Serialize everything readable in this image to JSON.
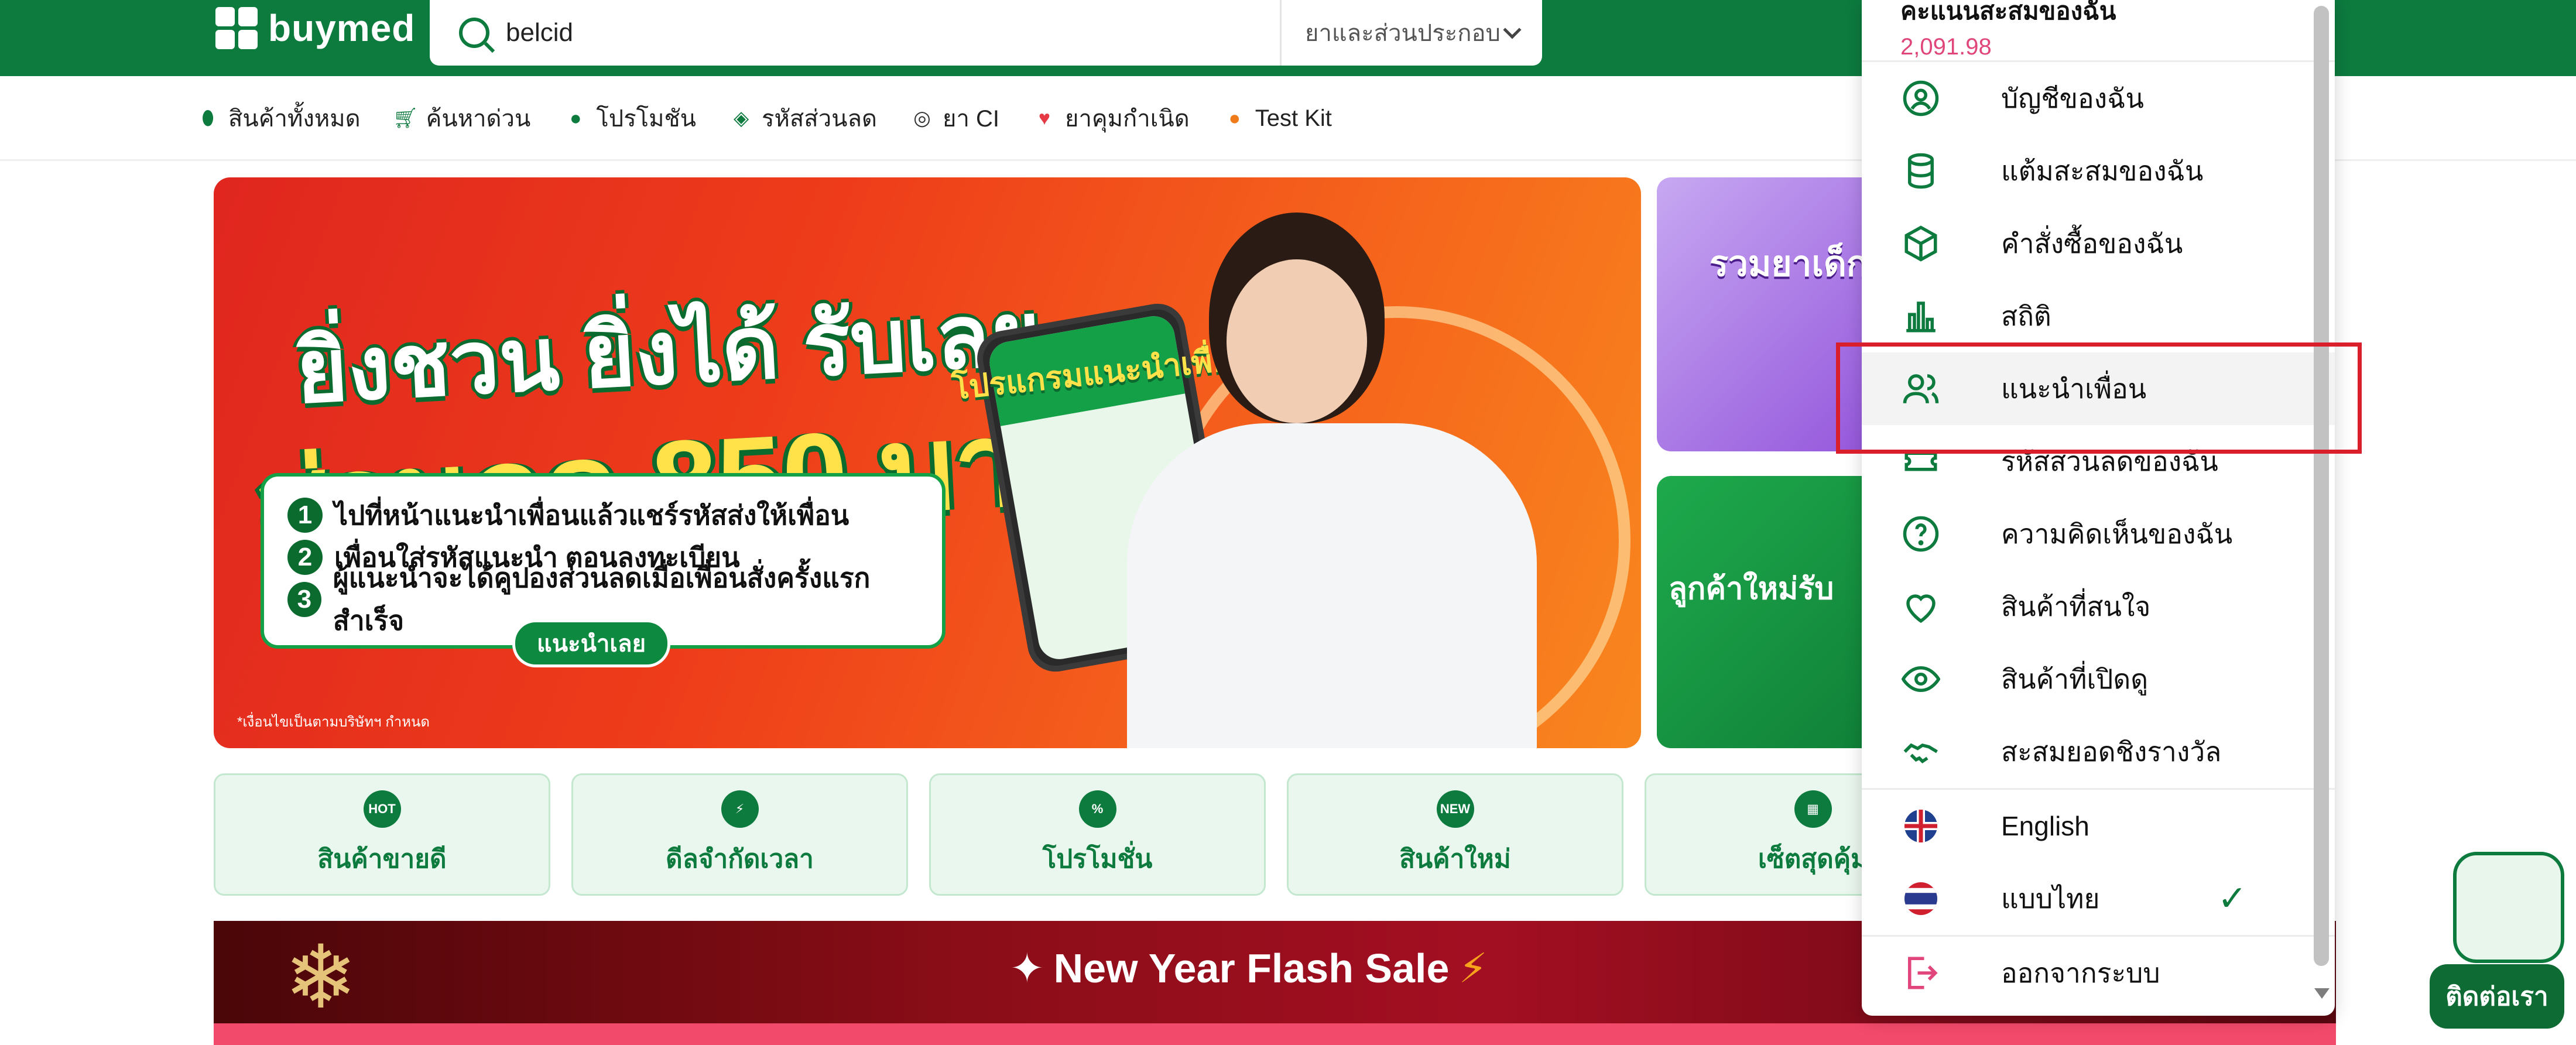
{
  "header": {
    "logo_text": "buymed",
    "search_value": "belcid",
    "search_category": "ยาและส่วนประกอบ"
  },
  "nav": {
    "items": [
      {
        "label": "สินค้าทั้งหมด",
        "icon": "pill-icon"
      },
      {
        "label": "ค้นหาด่วน",
        "icon": "cart-icon"
      },
      {
        "label": "โปรโมชัน",
        "icon": "flame-icon"
      },
      {
        "label": "รหัสส่วนลด",
        "icon": "coupon-icon"
      },
      {
        "label": "ยา CI",
        "icon": "medical-icon"
      },
      {
        "label": "ยาคุมกำเนิด",
        "icon": "heart-icon"
      },
      {
        "label": "Test Kit",
        "icon": "fire-icon"
      }
    ]
  },
  "banner": {
    "headline1": "ยิ่งชวน ยิ่งได้ รับเลย",
    "headline2": "ส่วนลด 850 บาท",
    "tag": "โปรแกรมแนะนำเพื่อน",
    "steps": [
      "ไปที่หน้าแนะนำเพื่อนแล้วแชร์รหัสส่งให้เพื่อน",
      "เพื่อนใส่รหัสแนะนำ ตอนลงทะเบียน",
      "ผู้แนะนำจะได้คูปองส่วนลดเมื่อเพื่อนสั่งครั้งแรกสำเร็จ"
    ],
    "cta": "แนะนำเลย",
    "note": "*เงื่อนไขเป็นตามบริษัทฯ กำหนด"
  },
  "side_banners": {
    "top_title": "รวมยาเด็ก",
    "bottom_title": "ลูกค้าใหม่รับ"
  },
  "categories": [
    {
      "label": "สินค้าขายดี",
      "icon_text": "HOT"
    },
    {
      "label": "ดีลจำกัดเวลา",
      "icon_text": "⚡"
    },
    {
      "label": "โปรโมชั่น",
      "icon_text": "%"
    },
    {
      "label": "สินค้าใหม่",
      "icon_text": "NEW"
    },
    {
      "label": "เซ็ตสุดคุ้ม",
      "icon_text": "▦"
    }
  ],
  "flash_sale": {
    "title": "New Year Flash Sale"
  },
  "dropdown": {
    "points_label": "คะแนนสะสมของฉัน",
    "points_value": "2,091.98",
    "items": [
      {
        "label": "บัญชีของฉัน",
        "icon": "user-circle-icon"
      },
      {
        "label": "แต้มสะสมของฉัน",
        "icon": "coins-icon"
      },
      {
        "label": "คำสั่งซื้อของฉัน",
        "icon": "box-icon"
      },
      {
        "label": "สถิติ",
        "icon": "bar-chart-icon"
      },
      {
        "label": "แนะนำเพื่อน",
        "icon": "users-icon"
      },
      {
        "label": "รหัสส่วนลดของฉัน",
        "icon": "ticket-icon"
      },
      {
        "label": "ความคิดเห็นของฉัน",
        "icon": "question-icon"
      },
      {
        "label": "สินค้าที่สนใจ",
        "icon": "heart-icon"
      },
      {
        "label": "สินค้าที่เปิดดู",
        "icon": "eye-icon"
      },
      {
        "label": "สะสมยอดชิงรางวัล",
        "icon": "handshake-icon"
      }
    ],
    "languages": [
      {
        "label": "English",
        "icon": "uk-flag-icon"
      },
      {
        "label": "แบบไทย",
        "icon": "thai-flag-icon",
        "selected": true
      }
    ],
    "logout": "ออกจากระบบ"
  },
  "contact_button": "ติดต่อเรา",
  "colors": {
    "brand_green": "#0d7a3e",
    "points_pink": "#e0467b",
    "highlight_red": "#d81f2b"
  }
}
